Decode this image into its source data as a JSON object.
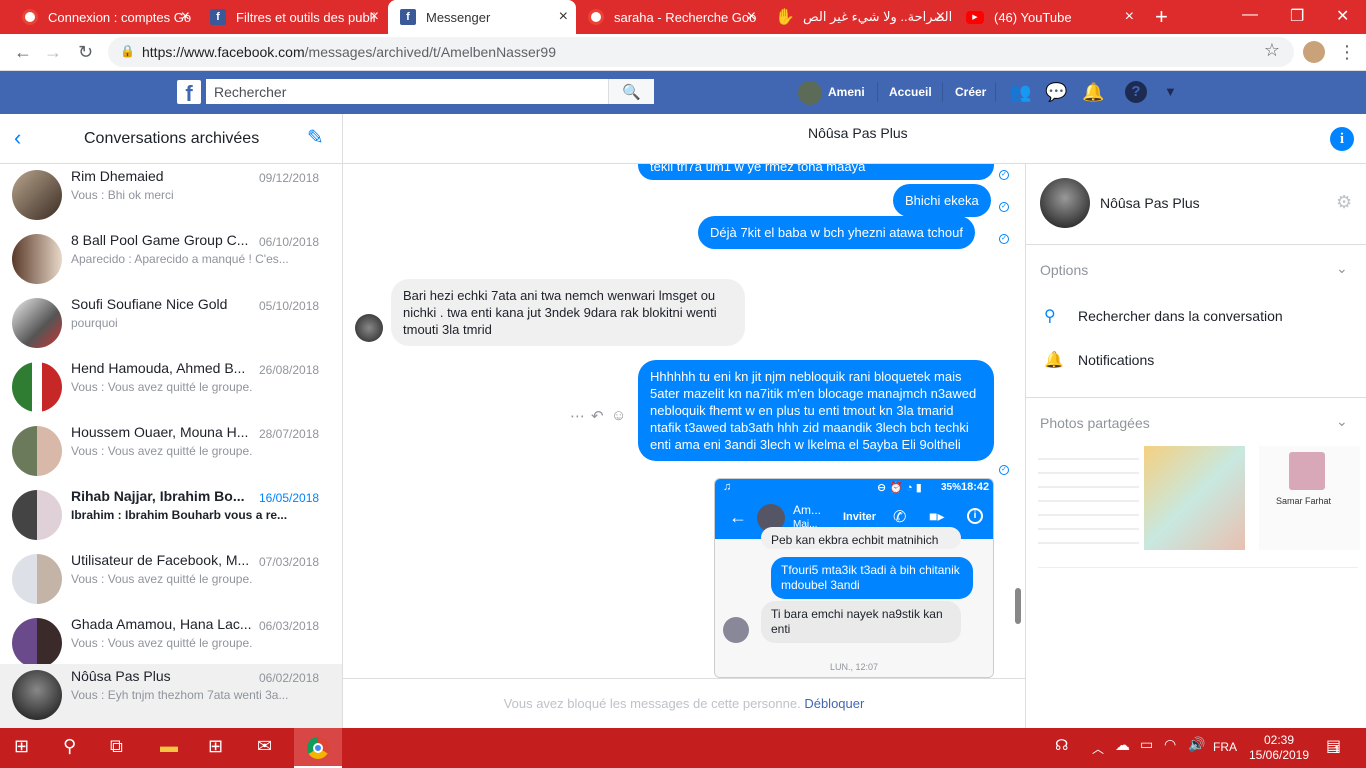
{
  "browser": {
    "tabs": [
      {
        "title": "Connexion : comptes Go",
        "icon": "google-icon"
      },
      {
        "title": "Filtres et outils des publi",
        "icon": "facebook-icon"
      },
      {
        "title": "Messenger",
        "icon": "facebook-icon",
        "active": true
      },
      {
        "title": "saraha - Recherche Goo",
        "icon": "google-icon"
      },
      {
        "title": "الصراحة.. ولا شيء غير الص",
        "icon": "hand-icon"
      },
      {
        "title": "(46) YouTube",
        "icon": "youtube-icon"
      }
    ],
    "new_tab": "+",
    "url_host": "https://www.facebook.com",
    "url_path": "/messages/archived/t/AmelbenNasser99"
  },
  "fb": {
    "logo": "f",
    "search_placeholder": "Rechercher",
    "user_name": "Ameni",
    "nav_home": "Accueil",
    "nav_create": "Créer"
  },
  "left": {
    "title": "Conversations archivées",
    "conversations": [
      {
        "name": "Rim Dhemaied",
        "date": "09/12/2018",
        "preview": "Vous : Bhi ok merci"
      },
      {
        "name": "8 Ball Pool Game Group C...",
        "date": "06/10/2018",
        "preview": "Aparecido : Aparecido a manqué ! C'es..."
      },
      {
        "name": "Soufi Soufiane Nice Gold",
        "date": "05/10/2018",
        "preview": "pourquoi"
      },
      {
        "name": "Hend Hamouda, Ahmed B...",
        "date": "26/08/2018",
        "preview": "Vous : Vous avez quitté le groupe."
      },
      {
        "name": "Houssem Ouaer, Mouna H...",
        "date": "28/07/2018",
        "preview": "Vous : Vous avez quitté le groupe."
      },
      {
        "name": "Rihab Najjar, Ibrahim Bo...",
        "date": "16/05/2018",
        "preview": "Ibrahim : Ibrahim Bouharb vous a re..."
      },
      {
        "name": "Utilisateur de Facebook, M...",
        "date": "07/03/2018",
        "preview": "Vous : Vous avez quitté le groupe."
      },
      {
        "name": "Ghada Amamou, Hana Lac...",
        "date": "06/03/2018",
        "preview": "Vous : Vous avez quitté le groupe."
      },
      {
        "name": "Nôûsa Pas Plus",
        "date": "06/02/2018",
        "preview": "Vous : Eyh tnjm thezhom 7ata wenti 3a..."
      }
    ]
  },
  "chat": {
    "name": "Nôûsa Pas Plus",
    "messages": {
      "m0": "tekli tri7a um1 w ye rmez tona maaya",
      "m1": "Bhichi ekeka",
      "m2": "Déjà 7kit el baba w bch yhezni atawa tchouf",
      "m3": "Bari hezi echki 7ata ani twa nemch wenwari lmsget ou nichki . twa enti kana jut 3ndek 9dara rak blokitni wenti tmouti 3la tmrid",
      "m4": "Hhhhhh tu eni kn jit njm nebloquik rani bloquetek mais 5ater mazelit kn na7itik m'en blocage manajmch n3awed nebloquik fhemt w en plus tu enti tmout kn 3la tmarid ntafik t3awed tab3ath hhh zid maandik 3lech bch techki enti ama eni 3andi 3lech w lkelma el 5ayba Eli 9oltheli"
    },
    "phone": {
      "status_battery": "35%",
      "status_time": "18:42",
      "contact": "Am...",
      "contact_sub": "Mai...",
      "invite": "Inviter",
      "top_cut": "Peb kan ekbra echbit matnihich",
      "msg_out": "Tfouri5 mta3ik t3adi à bih chitanik mdoubel 3andi",
      "msg_in": "Ti bara emchi nayek na9stik kan enti",
      "date": "LUN., 12:07"
    },
    "footer_text": "Vous avez bloqué les messages de cette personne.",
    "footer_link": "Débloquer"
  },
  "right": {
    "name": "Nôûsa Pas Plus",
    "options_title": "Options",
    "search_conv": "Rechercher dans la conversation",
    "notifications": "Notifications",
    "photos_title": "Photos partagées",
    "thumb_name": "Samar Farhat"
  },
  "taskbar": {
    "lang": "FRA",
    "time": "02:39",
    "date": "15/06/2019",
    "notif_count": "1"
  }
}
